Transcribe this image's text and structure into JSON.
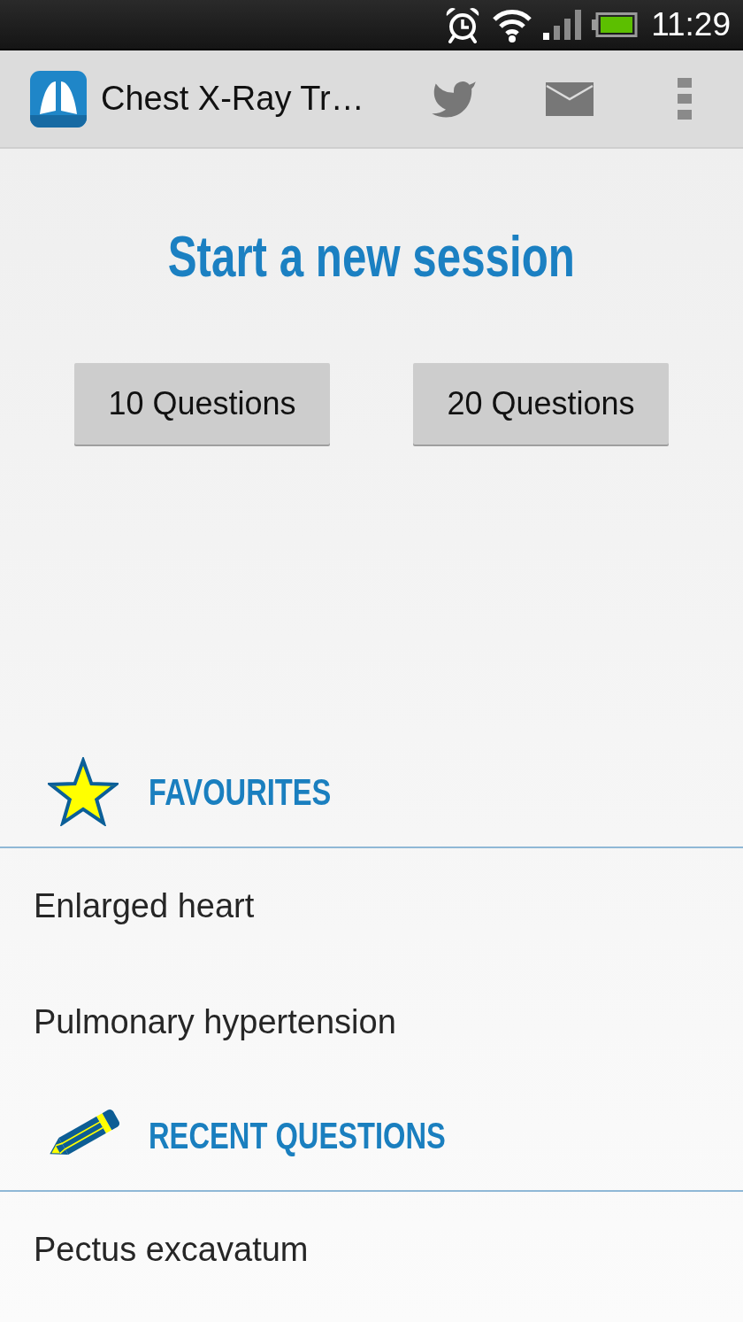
{
  "status_bar": {
    "time": "11:29"
  },
  "app_bar": {
    "title": "Chest X-Ray Tr…"
  },
  "session": {
    "heading": "Start a new session",
    "buttons": [
      "10 Questions",
      "20 Questions"
    ]
  },
  "sections": [
    {
      "kind": "favourites",
      "title": "FAVOURITES",
      "items": [
        "Enlarged heart",
        "Pulmonary hypertension"
      ]
    },
    {
      "kind": "recent",
      "title": "RECENT QUESTIONS",
      "items": [
        "Pectus excavatum"
      ]
    }
  ]
}
